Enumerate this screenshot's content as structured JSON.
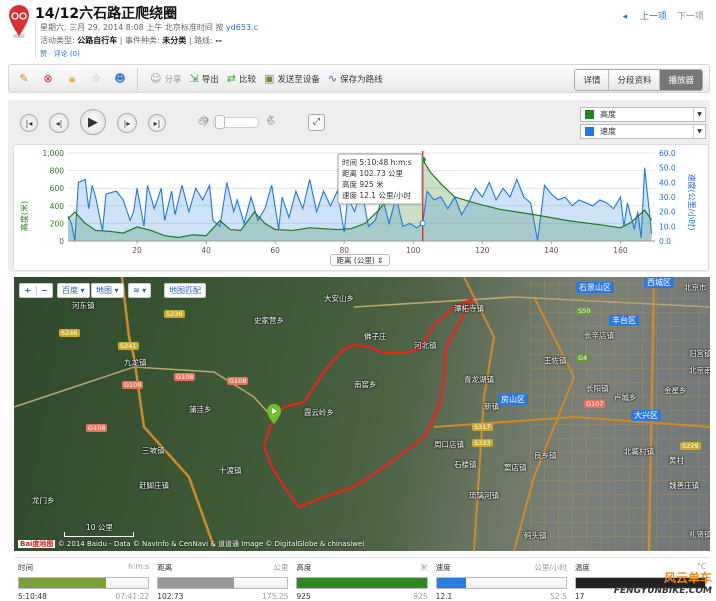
{
  "header": {
    "title": "14/12六石路正爬绕圈",
    "date": "星期六, 三月 29, 2014 8:08 上午 北京标准时间 按",
    "user": "yd653.c",
    "activity_type_label": "活动类型:",
    "activity_type": "公路自行车",
    "event_type_label": "事件种类:",
    "event_type": "未分类",
    "route_label": "路线:",
    "route": "--",
    "like": "赞",
    "comments": "评论 (0)",
    "prev": "上一项",
    "next": "下一项"
  },
  "toolbar": {
    "share": "分享",
    "export": "导出",
    "compare": "比较",
    "send": "发送至设备",
    "save_route": "保存为路线",
    "tabs": [
      "详情",
      "分段资料",
      "播放器"
    ],
    "active_tab": "播放器"
  },
  "player": {
    "metric1": "高度",
    "metric2": "速度",
    "color1": "#1e8a1e",
    "color2": "#1e78e6",
    "x_select": "距离 (公里)"
  },
  "tooltip": {
    "time": "时间 5:10:48 h:m:s",
    "distance": "距离 102.73 公里",
    "elevation": "高度 925 米",
    "speed": "速度 12.1 公里/小时"
  },
  "chart_data": {
    "type": "area",
    "xlabel": "距离 (公里)",
    "ylabel_left": "高度(米)",
    "ylabel_right": "速度(公里/小时)",
    "xlim": [
      0,
      170
    ],
    "ylim_left": [
      0,
      1000
    ],
    "ylim_right": [
      0,
      60
    ],
    "xticks": [
      "20",
      "40",
      "60",
      "80",
      "100",
      "120",
      "140",
      "160"
    ],
    "yticks_left": [
      "0",
      "200",
      "400",
      "600",
      "800",
      "1,000"
    ],
    "yticks_right": [
      "0.0",
      "10.0",
      "20.0",
      "30.0",
      "40.0",
      "50.0",
      "60.0"
    ],
    "cursor_x": 102.73,
    "elevation": [
      [
        0,
        250
      ],
      [
        2,
        330
      ],
      [
        5,
        200
      ],
      [
        8,
        120
      ],
      [
        12,
        110
      ],
      [
        16,
        90
      ],
      [
        20,
        160
      ],
      [
        24,
        120
      ],
      [
        28,
        60
      ],
      [
        32,
        40
      ],
      [
        36,
        70
      ],
      [
        40,
        60
      ],
      [
        44,
        230
      ],
      [
        47,
        130
      ],
      [
        50,
        120
      ],
      [
        54,
        330
      ],
      [
        57,
        200
      ],
      [
        60,
        130
      ],
      [
        65,
        120
      ],
      [
        70,
        150
      ],
      [
        78,
        130
      ],
      [
        82,
        140
      ],
      [
        86,
        200
      ],
      [
        90,
        350
      ],
      [
        95,
        600
      ],
      [
        100,
        850
      ],
      [
        102.7,
        925
      ],
      [
        105,
        780
      ],
      [
        108,
        650
      ],
      [
        112,
        500
      ],
      [
        118,
        430
      ],
      [
        125,
        360
      ],
      [
        135,
        300
      ],
      [
        145,
        230
      ],
      [
        155,
        180
      ],
      [
        160,
        150
      ],
      [
        163,
        210
      ],
      [
        167,
        350
      ],
      [
        169,
        240
      ]
    ],
    "speed": [
      [
        0,
        17
      ],
      [
        1,
        12
      ],
      [
        2,
        0
      ],
      [
        3,
        40
      ],
      [
        5,
        42
      ],
      [
        6,
        22
      ],
      [
        7,
        38
      ],
      [
        8,
        30
      ],
      [
        10,
        7
      ],
      [
        11,
        32
      ],
      [
        14,
        34
      ],
      [
        16,
        28
      ],
      [
        18,
        14
      ],
      [
        19,
        20
      ],
      [
        20,
        36
      ],
      [
        22,
        10
      ],
      [
        23,
        38
      ],
      [
        25,
        22
      ],
      [
        27,
        36
      ],
      [
        28,
        14
      ],
      [
        30,
        34
      ],
      [
        31,
        18
      ],
      [
        33,
        38
      ],
      [
        35,
        20
      ],
      [
        37,
        36
      ],
      [
        39,
        28
      ],
      [
        41,
        38
      ],
      [
        42,
        14
      ],
      [
        44,
        10
      ],
      [
        46,
        40
      ],
      [
        48,
        20
      ],
      [
        49,
        28
      ],
      [
        51,
        12
      ],
      [
        53,
        30
      ],
      [
        55,
        14
      ],
      [
        57,
        22
      ],
      [
        59,
        38
      ],
      [
        61,
        8
      ],
      [
        62,
        30
      ],
      [
        64,
        16
      ],
      [
        66,
        34
      ],
      [
        68,
        22
      ],
      [
        70,
        42
      ],
      [
        72,
        20
      ],
      [
        74,
        34
      ],
      [
        76,
        24
      ],
      [
        78,
        34
      ],
      [
        80,
        6
      ],
      [
        81,
        30
      ],
      [
        83,
        20
      ],
      [
        85,
        36
      ],
      [
        87,
        10
      ],
      [
        89,
        14
      ],
      [
        91,
        30
      ],
      [
        93,
        12
      ],
      [
        95,
        30
      ],
      [
        97,
        10
      ],
      [
        99,
        12
      ],
      [
        101,
        9
      ],
      [
        102.7,
        12
      ],
      [
        104,
        34
      ],
      [
        106,
        28
      ],
      [
        108,
        30
      ],
      [
        110,
        22
      ],
      [
        112,
        30
      ],
      [
        114,
        18
      ],
      [
        116,
        26
      ],
      [
        118,
        36
      ],
      [
        120,
        30
      ],
      [
        122,
        40
      ],
      [
        124,
        28
      ],
      [
        126,
        36
      ],
      [
        128,
        30
      ],
      [
        130,
        42
      ],
      [
        132,
        30
      ],
      [
        134,
        26
      ],
      [
        136,
        0
      ],
      [
        138,
        38
      ],
      [
        140,
        32
      ],
      [
        142,
        28
      ],
      [
        144,
        30
      ],
      [
        146,
        24
      ],
      [
        148,
        28
      ],
      [
        150,
        26
      ],
      [
        152,
        24
      ],
      [
        154,
        28
      ],
      [
        156,
        26
      ],
      [
        158,
        22
      ],
      [
        160,
        30
      ],
      [
        161,
        10
      ],
      [
        162,
        26
      ],
      [
        164,
        8
      ],
      [
        165,
        20
      ],
      [
        166,
        2
      ],
      [
        167,
        50
      ],
      [
        168,
        28
      ],
      [
        169,
        5
      ]
    ]
  },
  "map": {
    "controls": {
      "zoom_in": "+",
      "zoom_out": "−",
      "provider": "百度",
      "map_type": "地图",
      "layers": "≋",
      "match": "地图匹配"
    },
    "labels": [
      "河东镇",
      "大安山乡",
      "史家营乡",
      "九龙镇",
      "佛子庄",
      "河北镇",
      "南窖乡",
      "霞云岭乡",
      "蒲洼乡",
      "三坡镇",
      "十渡镇",
      "赶脚庄镇",
      "龙门乡",
      "潭柘寺镇",
      "长辛店镇",
      "王佐镇",
      "青龙湖镇",
      "长阳镇",
      "周口店镇",
      "石楼镇",
      "良乡镇",
      "窦店镇",
      "琉璃河镇",
      "北臧村镇",
      "黄村",
      "魏善庄镇",
      "礼贤镇",
      "码头镇",
      "旧宫镇",
      "北京南站",
      "新镇",
      "卢城乡",
      "金星乡",
      "北京市"
    ],
    "districts": [
      "石景山区",
      "西城区",
      "丰台区",
      "房山区",
      "大兴区"
    ],
    "roads": [
      "S236",
      "S246",
      "S241",
      "G108",
      "G108",
      "G108",
      "G108",
      "S50",
      "G4",
      "G107",
      "S317",
      "S333",
      "S229"
    ],
    "scale": "10 公里",
    "copyright": "© 2014 Baidu - Data © NavInfo & CenNavi & 道道通 Image © DigitalGlobe & chinasiwei",
    "logo": "Bai度地图"
  },
  "stats": [
    {
      "label": "时间",
      "unit": "h:m:s",
      "value": "5:10:48",
      "max": "07:41:22",
      "fraction": 0.67,
      "color": "#7aa03a"
    },
    {
      "label": "距离",
      "unit": "公里",
      "value": "102.73",
      "max": "175.25",
      "fraction": 0.59,
      "color": "#999999"
    },
    {
      "label": "高度",
      "unit": "米",
      "value": "925",
      "max": "925",
      "fraction": 1.0,
      "color": "#2e8a1e"
    },
    {
      "label": "速度",
      "unit": "公里/小时",
      "value": "12.1",
      "max": "52.5",
      "fraction": 0.23,
      "color": "#2b7de0"
    },
    {
      "label": "温度",
      "unit": "°C",
      "value": "17",
      "max": "",
      "fraction": 1.0,
      "color": "#222222"
    }
  ],
  "watermark": {
    "cn": "风云单车",
    "en": "FENGYUNBIKE.COM"
  }
}
